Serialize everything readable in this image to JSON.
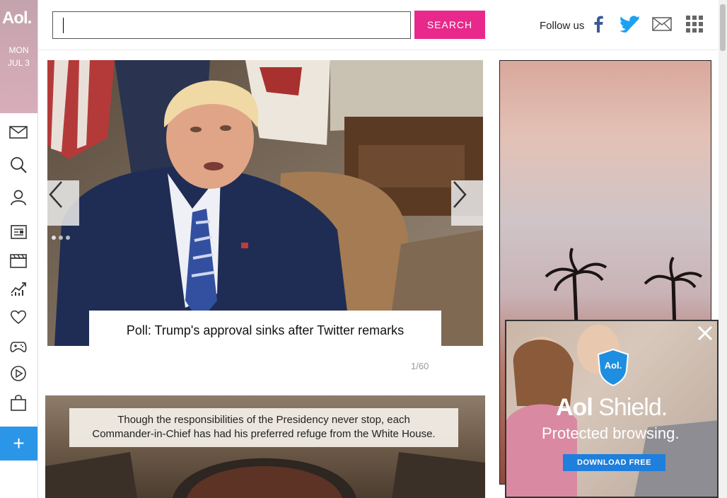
{
  "brand": {
    "logo": "Aol.",
    "day": "MON",
    "date": "JUL 3"
  },
  "rail": {
    "items": [
      "mail-icon",
      "search-icon",
      "user-icon",
      "news-icon",
      "movies-icon",
      "finance-icon",
      "lifestyle-icon",
      "games-icon",
      "video-icon",
      "shopping-icon"
    ],
    "plus": "+"
  },
  "header": {
    "search_value": "",
    "search_button": "SEARCH",
    "follow_label": "Follow us",
    "social": [
      "facebook-icon",
      "twitter-icon",
      "mail-icon",
      "apps-grid-icon"
    ]
  },
  "hero": {
    "caption": "Poll: Trump's approval sinks after Twitter remarks",
    "counter": "1/60"
  },
  "card2": {
    "text_line1": "Though the responsibilities of the Presidency never stop, each",
    "text_line2": "Commander-in-Chief has had his preferred refuge from the White House."
  },
  "ad": {
    "shield_badge": "Aol.",
    "title_bold": "Aol",
    "title_rest": " Shield.",
    "subtitle": "Protected browsing.",
    "button": "DOWNLOAD FREE"
  },
  "colors": {
    "accent_pink": "#e8288a",
    "accent_blue": "#2b96e8",
    "facebook": "#3b5998",
    "twitter": "#1da1f2"
  }
}
